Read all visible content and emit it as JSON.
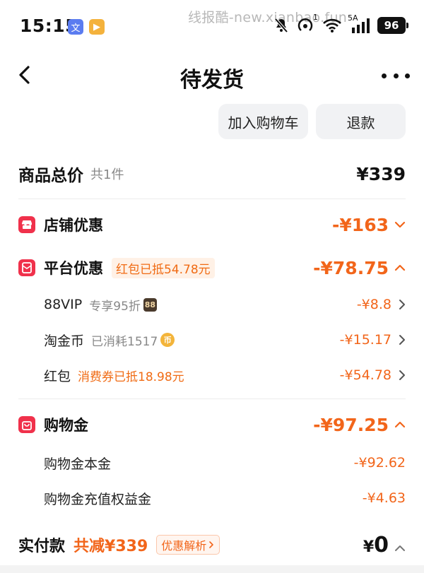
{
  "status_bar": {
    "time": "15:15",
    "badge_a": "文",
    "badge_b": "▶",
    "network": "5A",
    "wifi_badge": "1",
    "battery": "96"
  },
  "watermark": "线报酷-new.xianbao.fun",
  "nav": {
    "title": "待发货"
  },
  "actions": {
    "add_cart": "加入购物车",
    "refund": "退款"
  },
  "total": {
    "label": "商品总价",
    "count": "共1件",
    "amount": "¥339"
  },
  "store_discount": {
    "label": "店铺优惠",
    "amount": "-¥163"
  },
  "platform_discount": {
    "label": "平台优惠",
    "tag": "红包已抵54.78元",
    "amount": "-¥78.75",
    "items": [
      {
        "label": "88VIP",
        "note": "专享95折",
        "badge": "88",
        "amount": "-¥8.8"
      },
      {
        "label": "淘金币",
        "note": "已消耗1517",
        "badge": "币",
        "amount": "-¥15.17"
      },
      {
        "label": "红包",
        "note": "消费券已抵18.98元",
        "amount": "-¥54.78"
      }
    ]
  },
  "shopping_gold": {
    "label": "购物金",
    "amount": "-¥97.25",
    "items": [
      {
        "label": "购物金本金",
        "amount": "-¥92.62"
      },
      {
        "label": "购物金充值权益金",
        "amount": "-¥4.63"
      }
    ]
  },
  "payment": {
    "label": "实付款",
    "reduced": "共减¥339",
    "analysis": "优惠解析",
    "currency": "¥",
    "amount": "0"
  },
  "colors": {
    "accent_orange": "#f2651a",
    "icon_red": "#f0314b"
  }
}
